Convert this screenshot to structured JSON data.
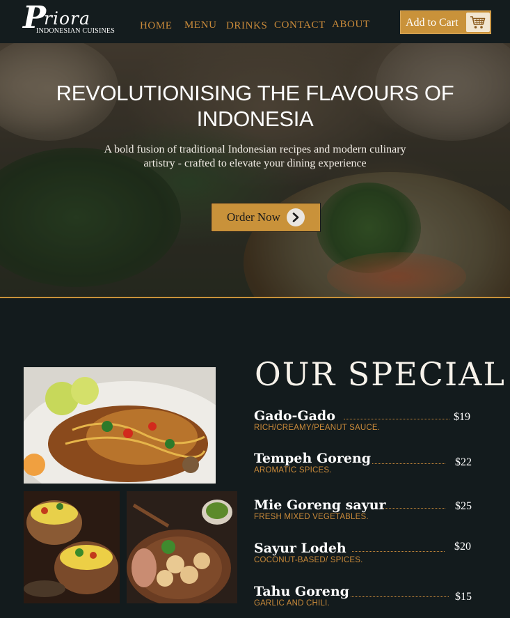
{
  "brand": {
    "logo_initial": "P",
    "logo_word": "riora",
    "subtitle": "INDONESIAN CUISINES"
  },
  "nav": {
    "items": [
      {
        "label": "HOME"
      },
      {
        "label": "MENU"
      },
      {
        "label": "DRINKS"
      },
      {
        "label": "CONTACT"
      },
      {
        "label": "ABOUT"
      }
    ]
  },
  "cart": {
    "label": "Add to Cart",
    "icon": "shopping-cart-icon"
  },
  "hero": {
    "title": "REVOLUTIONISING THE FLAVOURS OF INDONESIA",
    "subtitle": "A bold fusion of traditional Indonesian recipes and modern culinary artistry - crafted to elevate your dining experience",
    "cta_label": "Order Now",
    "cta_icon": "chevron-right-icon"
  },
  "specials": {
    "title": "OUR SPECIAL",
    "items": [
      {
        "name": "Gado-Gado",
        "description": "RICH/CREAMY/PEANUT SAUCE.",
        "price": "$19"
      },
      {
        "name": "Tempeh Goreng",
        "description": "AROMATIC SPICES.",
        "price": "$22"
      },
      {
        "name": "Mie Goreng sayur",
        "description": "FRESH  MIXED VEGETABLES.",
        "price": "$25"
      },
      {
        "name": "Sayur Lodeh",
        "description": "COCONUT-BASED/ SPICES.",
        "price": "$20"
      },
      {
        "name": "Tahu Goreng",
        "description": "GARLIC AND CHILI.",
        "price": "$15"
      }
    ]
  },
  "colors": {
    "accent": "#c9923a",
    "background": "#131b1d",
    "header": "#141c1e",
    "text": "#ffffff"
  }
}
